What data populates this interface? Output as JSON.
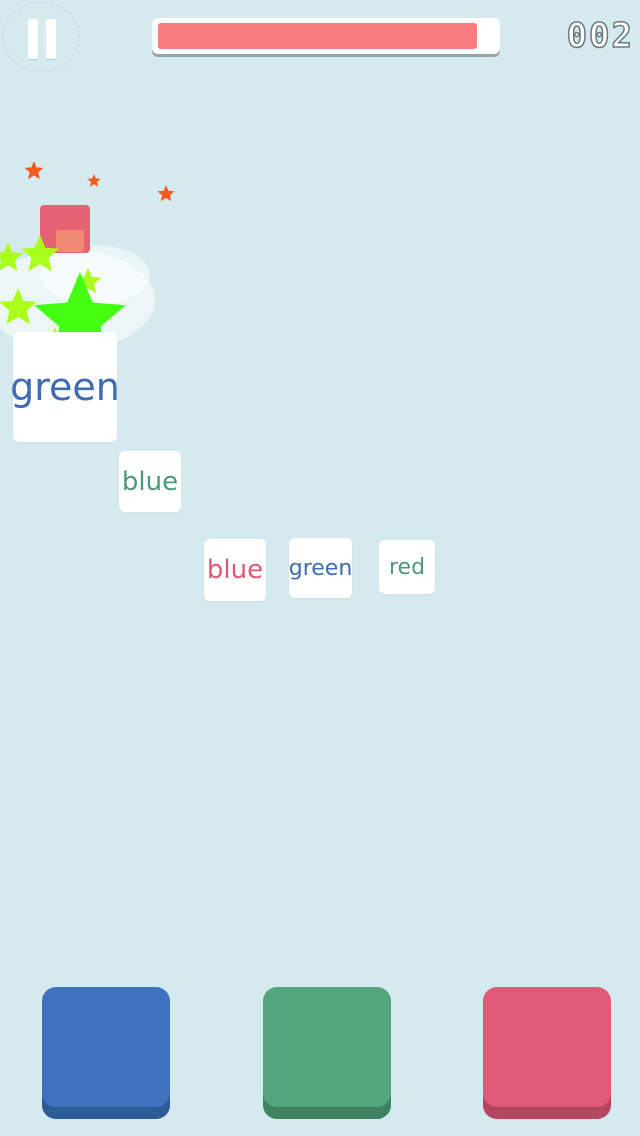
{
  "hud": {
    "score": "002",
    "progress": 0.95
  },
  "cards": {
    "active": {
      "word": "green",
      "text_color": "#3e6db5"
    },
    "next": {
      "word": "blue",
      "text_color": "#4d9a78"
    },
    "queue": [
      {
        "word": "blue",
        "text_color": "#e05a78"
      },
      {
        "word": "green",
        "text_color": "#3e6db5"
      },
      {
        "word": "red",
        "text_color": "#4d9a78"
      }
    ]
  },
  "buttons": [
    {
      "name": "blue",
      "color": "#3f73bd",
      "shade": "#2f5a98"
    },
    {
      "name": "green",
      "color": "#53a57d",
      "shade": "#3e8261"
    },
    {
      "name": "red",
      "color": "#e05a78",
      "shade": "#b5465f"
    }
  ],
  "colors": {
    "background": "#d5eaee",
    "progress_fill": "#f77d80",
    "star_orange": "#f25a1e",
    "star_green": "#44ff11",
    "star_lime": "#aaff1a"
  }
}
